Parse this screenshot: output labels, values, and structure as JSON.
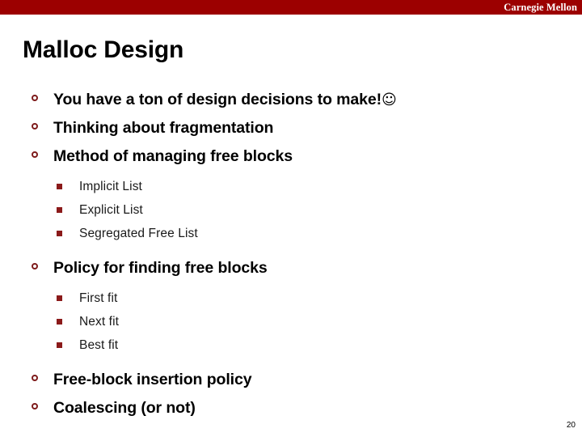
{
  "header": {
    "brand": "Carnegie Mellon",
    "band_color": "#9c0000",
    "brand_color": "#ffffff"
  },
  "slide": {
    "title": "Malloc Design",
    "page_number": "20",
    "bullet_marker_level1": "hollow-circle-marker",
    "bullet_marker_level2": "filled-square-marker",
    "marker_color": "#8b1a1a"
  },
  "bullets": [
    {
      "level": 1,
      "text": "You have a ton of design decisions to make!",
      "emoji": "☺"
    },
    {
      "level": 1,
      "text": "Thinking about fragmentation",
      "emoji": ""
    },
    {
      "level": 1,
      "text": "Method of managing free blocks",
      "emoji": ""
    },
    {
      "level": 2,
      "text": "Implicit List",
      "emoji": ""
    },
    {
      "level": 2,
      "text": "Explicit List",
      "emoji": ""
    },
    {
      "level": 2,
      "text": "Segregated Free List",
      "emoji": ""
    },
    {
      "level": 1,
      "text": "Policy for finding free blocks",
      "emoji": ""
    },
    {
      "level": 2,
      "text": "First fit",
      "emoji": ""
    },
    {
      "level": 2,
      "text": "Next fit",
      "emoji": ""
    },
    {
      "level": 2,
      "text": "Best fit",
      "emoji": ""
    },
    {
      "level": 1,
      "text": "Free-block insertion policy",
      "emoji": ""
    },
    {
      "level": 1,
      "text": "Coalescing (or not)",
      "emoji": ""
    }
  ]
}
